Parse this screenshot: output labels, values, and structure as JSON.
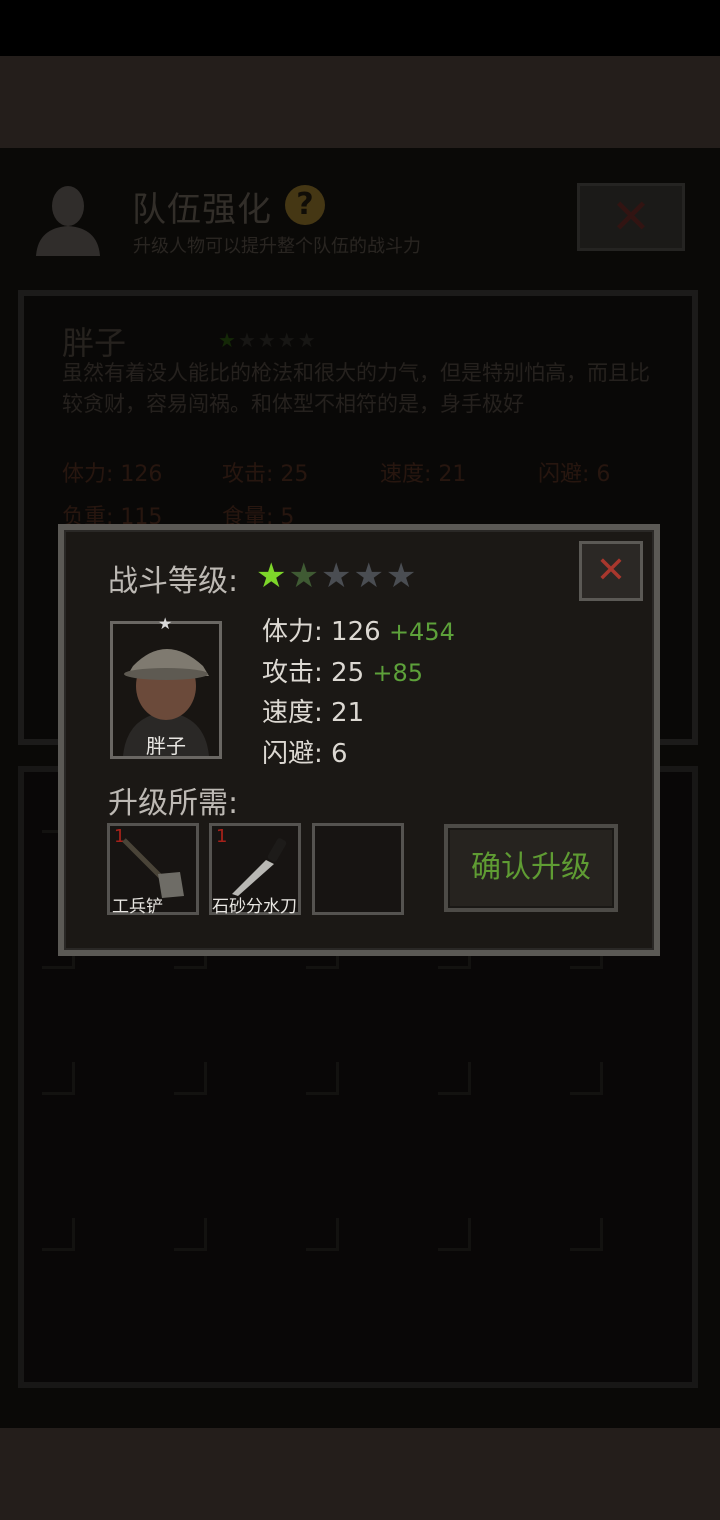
{
  "header": {
    "title": "队伍强化",
    "subtitle": "升级人物可以提升整个队伍的战斗力",
    "help_glyph": "?",
    "close_glyph": "✕"
  },
  "character": {
    "name": "胖子",
    "stars": "★★★★★",
    "description": "虽然有着没人能比的枪法和很大的力气，但是特别怕高，而且比较贪财，容易闯祸。和体型不相符的是，身手极好",
    "stats": {
      "hp": "体力: 126",
      "atk": "攻击: 25",
      "spd": "速度: 21",
      "dodge": "闪避: 6",
      "load": "负重: 115",
      "food": "食量: 5"
    }
  },
  "dialog": {
    "level_label": "战斗等级:",
    "stars": {
      "current": 1,
      "preview": 2,
      "max": 5
    },
    "close_glyph": "✕",
    "portrait_name": "胖子",
    "stats": [
      {
        "label": "体力:",
        "value": "126",
        "plus": "+454"
      },
      {
        "label": "攻击:",
        "value": "25",
        "plus": "+85"
      },
      {
        "label": "速度:",
        "value": "21",
        "plus": ""
      },
      {
        "label": "闪避:",
        "value": "6",
        "plus": ""
      }
    ],
    "requirements_label": "升级所需:",
    "requirements": [
      {
        "count": "1",
        "name": "工兵铲",
        "icon": "shovel-icon"
      },
      {
        "count": "1",
        "name": "石砂分水刀",
        "icon": "knife-icon"
      },
      {
        "count": "",
        "name": "",
        "icon": ""
      }
    ],
    "confirm_label": "确认升级"
  },
  "colors": {
    "star_on": "#7ed62a",
    "stat_plus": "#5da13a",
    "confirm_text": "#5f9c33",
    "close_x": "#a8372d"
  }
}
